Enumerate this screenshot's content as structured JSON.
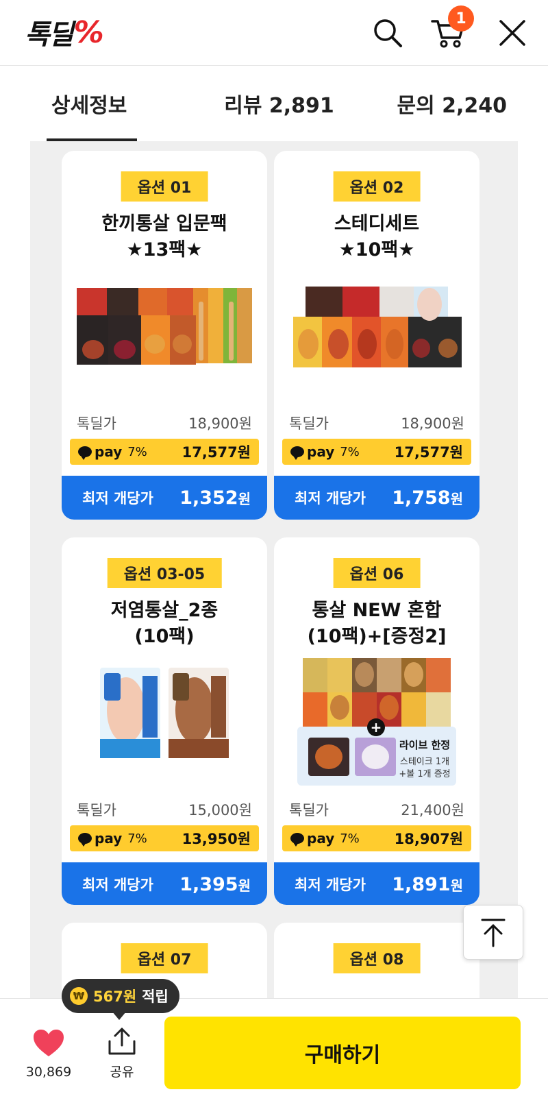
{
  "header": {
    "logo_text": "톡딜",
    "logo_mark": "%",
    "cart_count": "1"
  },
  "tabs": [
    {
      "label": "상세정보",
      "active": true
    },
    {
      "label": "리뷰 2,891",
      "active": false
    },
    {
      "label": "문의 2,240",
      "active": false
    }
  ],
  "options": [
    {
      "tag": "옵션 01",
      "title_line1": "한끼통살 입문팩",
      "title_line2": "★13팩★",
      "base_label": "톡딜가",
      "base_price": "18,900원",
      "pay_label": "pay",
      "pay_pct": "7%",
      "pay_price": "17,577원",
      "unit_label": "최저 개당가",
      "unit_price": "1,352",
      "unit_suffix": "원"
    },
    {
      "tag": "옵션 02",
      "title_line1": "스테디세트",
      "title_line2": "★10팩★",
      "base_label": "톡딜가",
      "base_price": "18,900원",
      "pay_label": "pay",
      "pay_pct": "7%",
      "pay_price": "17,577원",
      "unit_label": "최저 개당가",
      "unit_price": "1,758",
      "unit_suffix": "원"
    },
    {
      "tag": "옵션 03-05",
      "title_line1": "저염통살_2종",
      "title_line2": "(10팩)",
      "base_label": "톡딜가",
      "base_price": "15,000원",
      "pay_label": "pay",
      "pay_pct": "7%",
      "pay_price": "13,950원",
      "unit_label": "최저 개당가",
      "unit_price": "1,395",
      "unit_suffix": "원"
    },
    {
      "tag": "옵션 06",
      "title_line1": "통살 NEW 혼합",
      "title_line2": "(10팩)+[증정2]",
      "base_label": "톡딜가",
      "base_price": "21,400원",
      "pay_label": "pay",
      "pay_pct": "7%",
      "pay_price": "18,907원",
      "unit_label": "최저 개당가",
      "unit_price": "1,891",
      "unit_suffix": "원",
      "promo_title": "라이브 한정",
      "promo_line1": "스테이크 1개",
      "promo_line2": "+볼 1개 증정"
    },
    {
      "tag": "옵션 07"
    },
    {
      "tag": "옵션 08"
    }
  ],
  "bottom": {
    "like_count": "30,869",
    "share_label": "공유",
    "buy_label": "구매하기",
    "reward_coin": "₩",
    "reward_amount": "567원",
    "reward_suffix": "적립"
  },
  "colors": {
    "accent_yellow": "#ffe300",
    "pay_yellow": "#ffcc2e",
    "unit_blue": "#1a73e8",
    "badge_orange": "#ff5a1f",
    "heart_red": "#f0415a"
  }
}
